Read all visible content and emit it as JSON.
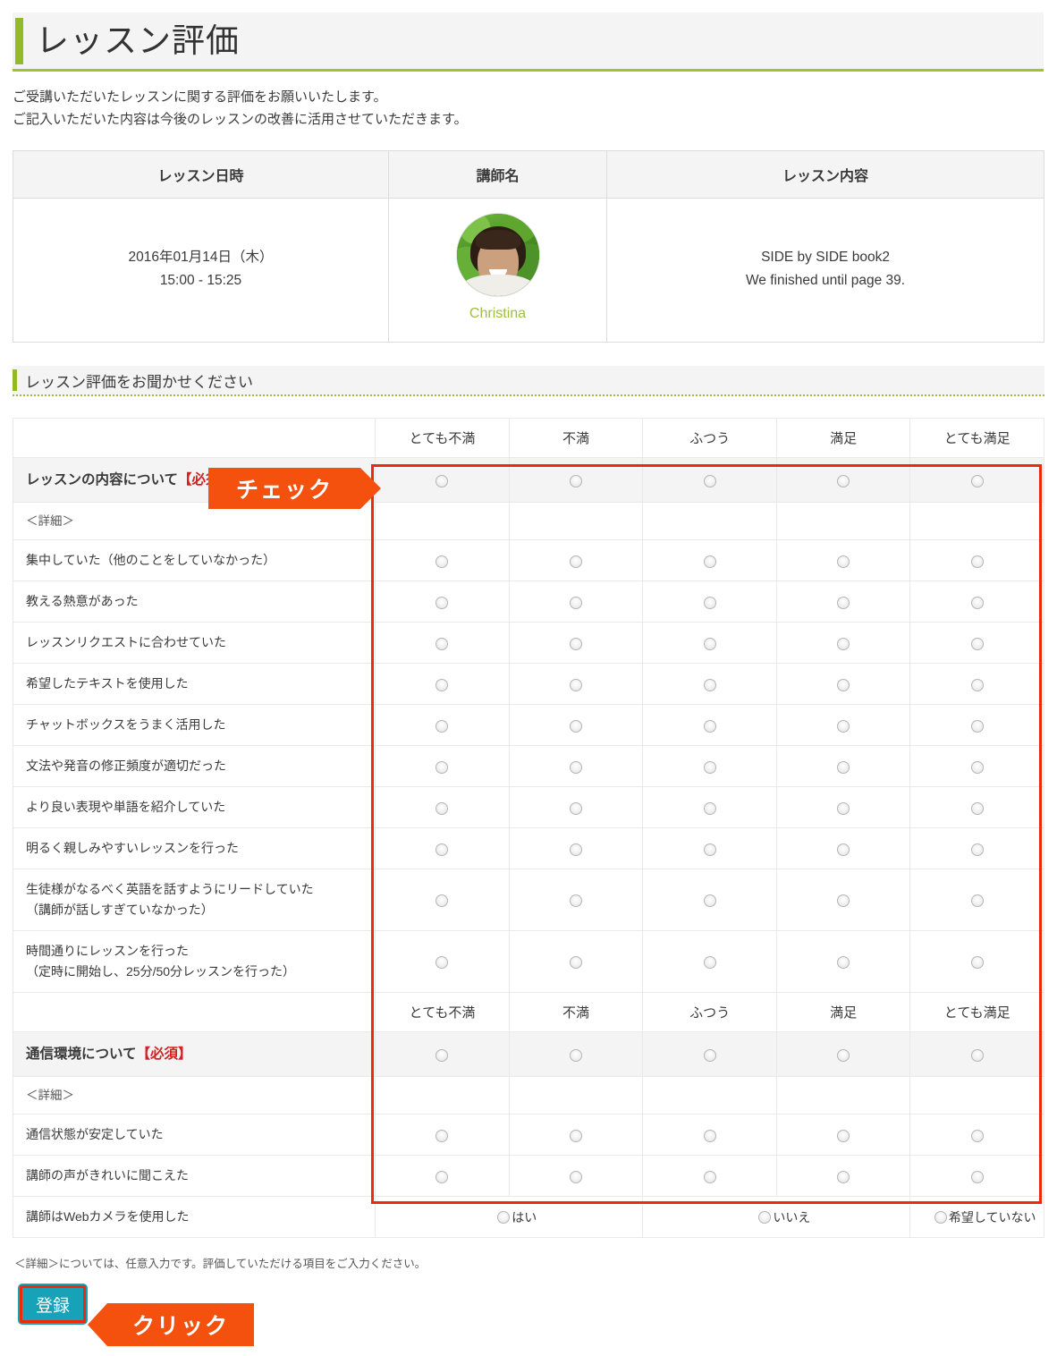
{
  "page": {
    "title": "レッスン評価",
    "lead_line1": "ご受講いただいたレッスンに関する評価をお願いいたします。",
    "lead_line2": "ご記入いただいた内容は今後のレッスンの改善に活用させていただきます。"
  },
  "lesson_info": {
    "headers": [
      "レッスン日時",
      "講師名",
      "レッスン内容"
    ],
    "date_line1": "2016年01月14日（木）",
    "date_line2": "15:00 - 15:25",
    "teacher_name": "Christina",
    "content_line1": "SIDE by SIDE book2",
    "content_line2": "We finished until page 39."
  },
  "section": {
    "heading": "レッスン評価をお聞かせください"
  },
  "scale": {
    "c1": "とても不満",
    "c2": "不満",
    "c3": "ふつう",
    "c4": "満足",
    "c5": "とても満足"
  },
  "rating": {
    "question1": "レッスンの内容について",
    "question1_required": "【必須】",
    "detail_label": "＜詳細＞",
    "items1": [
      "集中していた（他のことをしていなかった）",
      "教える熱意があった",
      "レッスンリクエストに合わせていた",
      "希望したテキストを使用した",
      "チャットボックスをうまく活用した",
      "文法や発音の修正頻度が適切だった",
      "より良い表現や単語を紹介していた",
      "明るく親しみやすいレッスンを行った"
    ],
    "item_lead_line1": "生徒様がなるべく英語を話すようにリードしていた",
    "item_lead_line2": "（講師が話しすぎていなかった）",
    "item_time_line1": "時間通りにレッスンを行った",
    "item_time_line2": "（定時に開始し、25分/50分レッスンを行った）",
    "question2": "通信環境について",
    "question2_required": "【必須】",
    "items2": [
      "通信状態が安定していた",
      "講師の声がきれいに聞こえた"
    ],
    "webcam_label": "講師はWebカメラを使用した",
    "webcam_options": [
      "はい",
      "いいえ",
      "希望していない"
    ]
  },
  "footnote": "＜詳細＞については、任意入力です。評価していただける項目をご入力ください。",
  "submit": {
    "label": "登録"
  },
  "callouts": {
    "check": "チェック",
    "click": "クリック"
  },
  "colors": {
    "accent_green": "#93b925",
    "callout_orange": "#f4510f",
    "highlight_red": "#ef2a0b",
    "submit_teal": "#17a2b8",
    "required_red": "#d32020",
    "teacher_name_green": "#9dbf3b"
  }
}
